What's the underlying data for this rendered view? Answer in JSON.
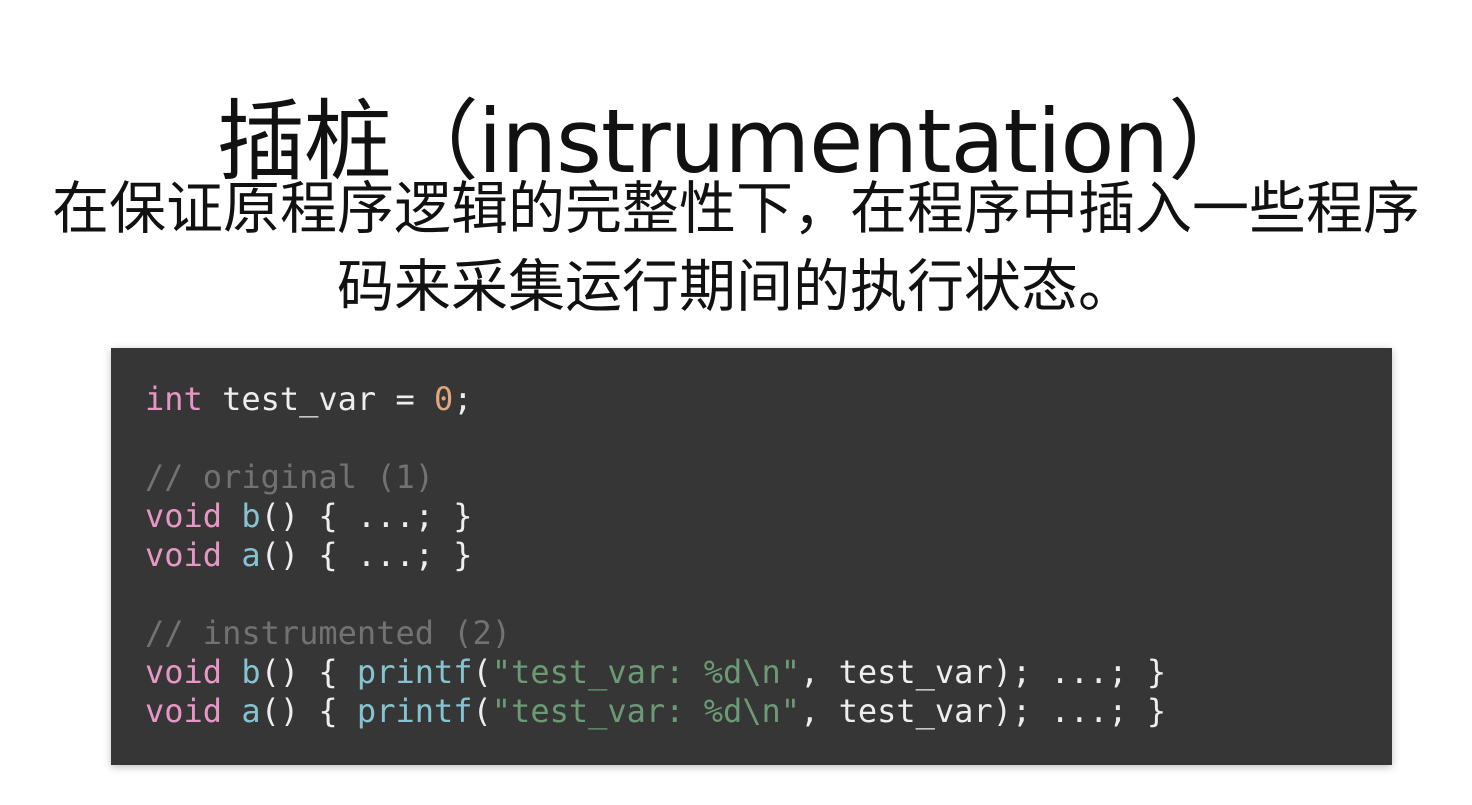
{
  "slide": {
    "title": "插桩（instrumentation）",
    "subtitle_line1": "在保证原程序逻辑的完整性下，在程序中插入一些程序",
    "subtitle_line2": "码来采集运行期间的执行状态。"
  },
  "code": {
    "line1": {
      "kw": "int",
      "rest": " test_var = ",
      "num": "0",
      "end": ";"
    },
    "comment1": "// original (1)",
    "line_b_orig": {
      "kw": "void",
      "fn": "b",
      "rest": "() { ...; }"
    },
    "line_a_orig": {
      "kw": "void",
      "fn": "a",
      "rest": "() { ...; }"
    },
    "comment2": "// instrumented (2)",
    "line_b_instr": {
      "kw": "void",
      "fn": "b",
      "pre": "() { ",
      "call": "printf",
      "open": "(",
      "str": "\"test_var: %d\\n\"",
      "post": ", test_var); ...; }"
    },
    "line_a_instr": {
      "kw": "void",
      "fn": "a",
      "pre": "() { ",
      "call": "printf",
      "open": "(",
      "str": "\"test_var: %d\\n\"",
      "post": ", test_var); ...; }"
    }
  },
  "colors": {
    "panel_background": "#363636",
    "keyword": "#e896c6",
    "function": "#86c3d0",
    "number": "#e0a77d",
    "string": "#6b9a74",
    "comment": "#727272",
    "plain": "#eeeeee"
  }
}
